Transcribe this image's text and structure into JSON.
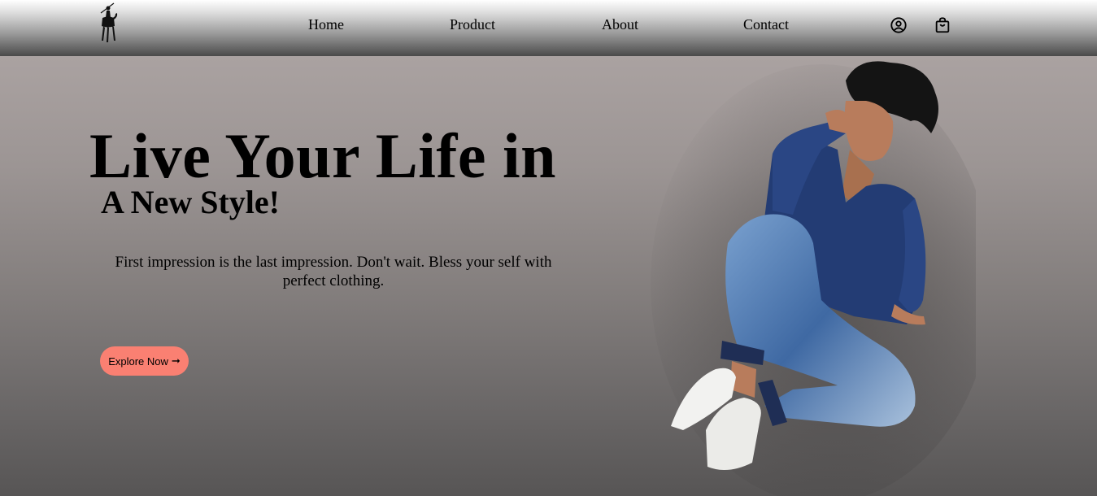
{
  "nav": {
    "logo_icon": "polo-player-logo-icon",
    "links": [
      "Home",
      "Product",
      "About",
      "Contact"
    ],
    "icons": [
      "user-circle-icon",
      "shopping-bag-icon"
    ]
  },
  "hero": {
    "title": "Live Your Life in",
    "subtitle": "A New Style!",
    "description": "First impression is the last impression. Don't wait. Bless your self with perfect clothing.",
    "button_label": "Explore Now",
    "button_icon": "arrow-right-icon",
    "button_color": "#fa8072",
    "photo": "model-sitting-photo"
  }
}
